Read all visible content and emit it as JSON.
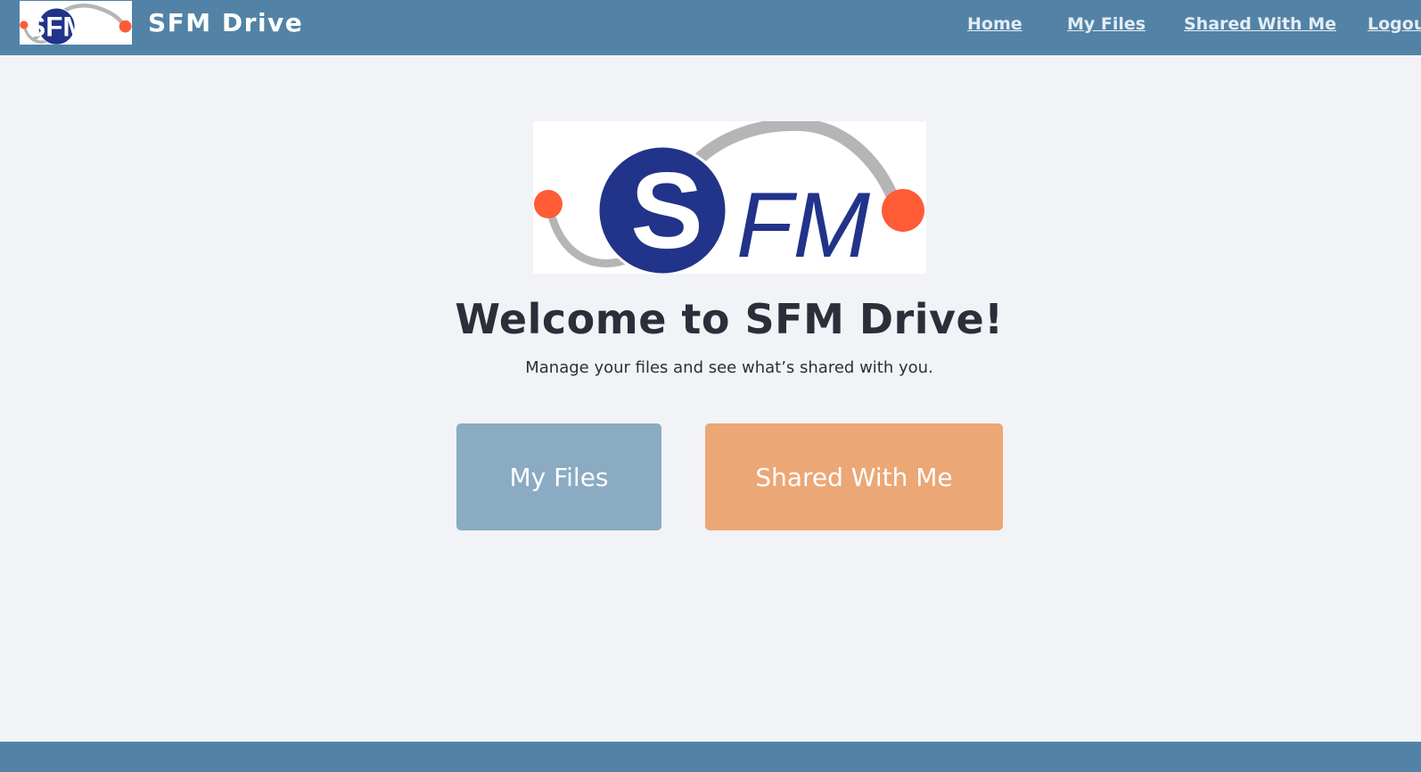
{
  "header": {
    "brand_logo_text": "SFM",
    "brand_name": "SFM Drive",
    "nav": {
      "home": "Home",
      "my_files": "My Files",
      "shared_with_me": "Shared With Me",
      "logout": "Logout"
    }
  },
  "main": {
    "logo_text": "SFM",
    "welcome_title": "Welcome to SFM Drive!",
    "subtitle": "Manage your files and see what’s shared with you.",
    "tiles": {
      "my_files": "My Files",
      "shared_with_me": "Shared With Me"
    }
  },
  "colors": {
    "header_bg": "#5283a6",
    "page_bg": "#f2f3f7",
    "my_files_tile": "#8aabc2",
    "shared_tile": "#eba776",
    "logo_navy": "#22338a",
    "logo_orange": "#ff5c35",
    "logo_arc_gray": "#b5b5b5"
  }
}
